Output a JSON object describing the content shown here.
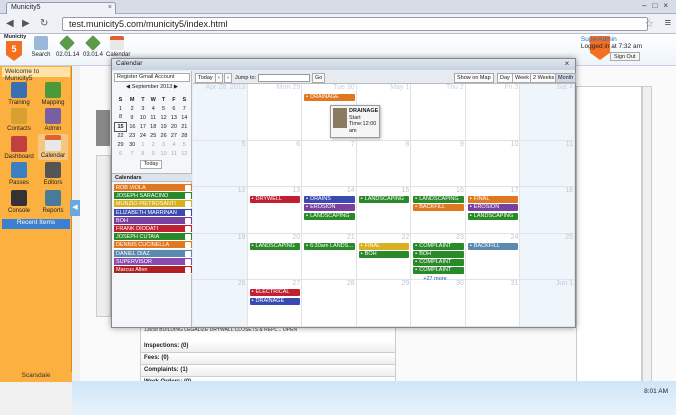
{
  "browser": {
    "tab_title": "Municity5",
    "url": "test.municity5.com/municity5/index.html"
  },
  "toolbar": {
    "search": "Search",
    "a": "02.01.14",
    "b": "03.01.4",
    "calendar": "Calendar"
  },
  "logo": {
    "top": "Municity",
    "letter": "5"
  },
  "sidebar": {
    "header": "Welcome to Municity5",
    "items": [
      {
        "label": "Training",
        "icon": "training-icon",
        "color": "#3a6fb0"
      },
      {
        "label": "Mapping",
        "icon": "mapping-icon",
        "color": "#4a9a3a"
      },
      {
        "label": "Contacts",
        "icon": "contacts-icon",
        "color": "#d8a030"
      },
      {
        "label": "Admin",
        "icon": "admin-icon",
        "color": "#7a5fa0"
      },
      {
        "label": "Dashboard",
        "icon": "dashboard-icon",
        "color": "#c04040"
      },
      {
        "label": "Calendar",
        "icon": "calendar-icon",
        "color": "#e06030"
      },
      {
        "label": "Passes",
        "icon": "passes-icon",
        "color": "#3a80c0"
      },
      {
        "label": "Editors",
        "icon": "editors-icon",
        "color": "#555"
      },
      {
        "label": "Console",
        "icon": "console-icon",
        "color": "#333"
      },
      {
        "label": "Reports",
        "icon": "reports-icon",
        "color": "#4a7a9a"
      }
    ],
    "recent": "Recent Items",
    "footer": "Scarsdale"
  },
  "user": {
    "name": "SuperAdmin",
    "logged": "Logged in at 7:32 am",
    "signout": "Sign Out"
  },
  "clock": "8:01 AM",
  "bg": {
    "sections": [
      "Inspections: (0)",
      "Fees: (0)",
      "Complaints: (1)",
      "Work Orders: (0)"
    ],
    "row": "13658     BUILDING     LEGALIZE DRYWALL CLOSETS & REPL...     OPEN"
  },
  "calendar": {
    "title": "Calendar",
    "gmail": "Register Gmail Account",
    "mini": {
      "month": "September 2013",
      "dow": [
        "S",
        "M",
        "T",
        "W",
        "T",
        "F",
        "S"
      ],
      "weeks": [
        [
          "1",
          "2",
          "3",
          "4",
          "5",
          "6",
          "7"
        ],
        [
          "8",
          "9",
          "10",
          "11",
          "12",
          "13",
          "14"
        ],
        [
          "15",
          "16",
          "17",
          "18",
          "19",
          "20",
          "21"
        ],
        [
          "22",
          "23",
          "24",
          "25",
          "26",
          "27",
          "28"
        ],
        [
          "29",
          "30",
          "1",
          "2",
          "3",
          "4",
          "5"
        ],
        [
          "6",
          "7",
          "8",
          "9",
          "10",
          "11",
          "12"
        ]
      ],
      "today_btn": "Today"
    },
    "cals_header": "Calendars",
    "calendars": [
      {
        "name": "ROB VIOLA",
        "color": "#e07820"
      },
      {
        "name": "JOSEPH SARACINO",
        "color": "#2a8a2a"
      },
      {
        "name": "MUNZIO PIETROSANTI",
        "color": "#d8b020"
      },
      {
        "name": "ELIZABETH MARRINAN",
        "color": "#3a4ab0"
      },
      {
        "name": "BOH",
        "color": "#7a40a0"
      },
      {
        "name": "FRANK DIODATI",
        "color": "#c02030"
      },
      {
        "name": "JOSEPH CUTAIA",
        "color": "#2a8a2a"
      },
      {
        "name": "DENNIS CUCINELLA",
        "color": "#e07820"
      },
      {
        "name": "DANIEL DIAZ",
        "color": "#5a8ab0"
      },
      {
        "name": "SUPERVISOR",
        "color": "#8a4ab0"
      },
      {
        "name": "Marcus Allen",
        "color": "#b02020"
      }
    ],
    "nav": {
      "today": "Today",
      "prev": "‹",
      "next": "›",
      "jump": "Jump to:",
      "go": "Go",
      "map": "Show on Map",
      "day": "Day",
      "week": "Week",
      "twoweeks": "2 Weeks",
      "month": "Month"
    },
    "day_headers": [
      "Apr 28, 2013",
      "Mon 29",
      "Tue 30",
      "May 1",
      "Thu 2",
      "Fri 3",
      "Sat 4"
    ],
    "weeks": [
      [
        "",
        "",
        "",
        "",
        "",
        "",
        ""
      ],
      [
        "5",
        "6",
        "7",
        "8",
        "9",
        "10",
        "11"
      ],
      [
        "12",
        "13",
        "14",
        "15",
        "16",
        "17",
        "18"
      ],
      [
        "19",
        "20",
        "21",
        "22",
        "23",
        "24",
        "25"
      ],
      [
        "26",
        "27",
        "28",
        "29",
        "30",
        "31",
        "Jun 1"
      ]
    ],
    "events": [
      {
        "w": 0,
        "d": 2,
        "text": "DRAINAGE",
        "color": "#e07820"
      },
      {
        "w": 2,
        "d": 1,
        "text": "DRYWELL",
        "color": "#c02030"
      },
      {
        "w": 2,
        "d": 2,
        "text": "DRAINS",
        "color": "#3a4ab0"
      },
      {
        "w": 2,
        "d": 2,
        "text": "EROSION",
        "color": "#7a40a0"
      },
      {
        "w": 2,
        "d": 2,
        "text": "LANDSCAPING",
        "color": "#2a8a2a"
      },
      {
        "w": 2,
        "d": 3,
        "text": "LANDSCAPING",
        "color": "#2a8a2a"
      },
      {
        "w": 2,
        "d": 4,
        "text": "LANDSCAPING",
        "color": "#2a8a2a"
      },
      {
        "w": 2,
        "d": 4,
        "text": "BACKFILL",
        "color": "#e07820"
      },
      {
        "w": 2,
        "d": 5,
        "text": "FINAL",
        "color": "#e07820"
      },
      {
        "w": 2,
        "d": 5,
        "text": "EROSION",
        "color": "#7a40a0"
      },
      {
        "w": 2,
        "d": 5,
        "text": "LANDSCAPING",
        "color": "#2a8a2a"
      },
      {
        "w": 3,
        "d": 1,
        "text": "LANDSCAPING",
        "color": "#2a8a2a"
      },
      {
        "w": 3,
        "d": 2,
        "text": "6:30am LANDS...",
        "color": "#2a8a2a"
      },
      {
        "w": 3,
        "d": 3,
        "text": "FINAL",
        "color": "#d8b020"
      },
      {
        "w": 3,
        "d": 3,
        "text": "BOH",
        "color": "#2a8a2a"
      },
      {
        "w": 3,
        "d": 4,
        "text": "COMPLAINT",
        "color": "#2a8a2a"
      },
      {
        "w": 3,
        "d": 4,
        "text": "BOH",
        "color": "#2a8a2a"
      },
      {
        "w": 3,
        "d": 4,
        "text": "COMPLAINT",
        "color": "#2a8a2a"
      },
      {
        "w": 3,
        "d": 4,
        "text": "COMPLAINT",
        "color": "#2a8a2a"
      },
      {
        "w": 3,
        "d": 5,
        "text": "BACKFILL",
        "color": "#5a8ab0"
      },
      {
        "w": 4,
        "d": 1,
        "text": "ELECTRICAL",
        "color": "#c02030"
      },
      {
        "w": 4,
        "d": 1,
        "text": "DRAINAGE",
        "color": "#3a4ab0"
      }
    ],
    "more": "+27 more",
    "tooltip": [
      "DRAINAGE",
      "Start",
      "Time:12:00",
      "am"
    ]
  }
}
